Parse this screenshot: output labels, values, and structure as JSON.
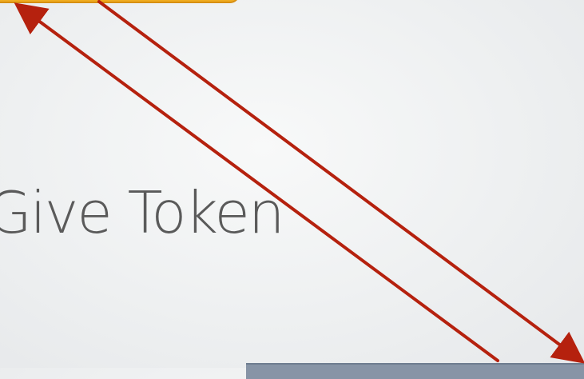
{
  "slide": {
    "label": "Give Token"
  },
  "colors": {
    "background": "#eef0f1",
    "arrow": "#b5210e",
    "top_box_fill": "#f0ac20",
    "bottom_box_fill": "#8794a6",
    "label_text": "#5a5a5a"
  },
  "arrows": [
    {
      "from": "bottom-box",
      "to": "top-box",
      "direction": "up-left"
    },
    {
      "from": "top-box",
      "to": "bottom-box",
      "direction": "down-right"
    }
  ]
}
